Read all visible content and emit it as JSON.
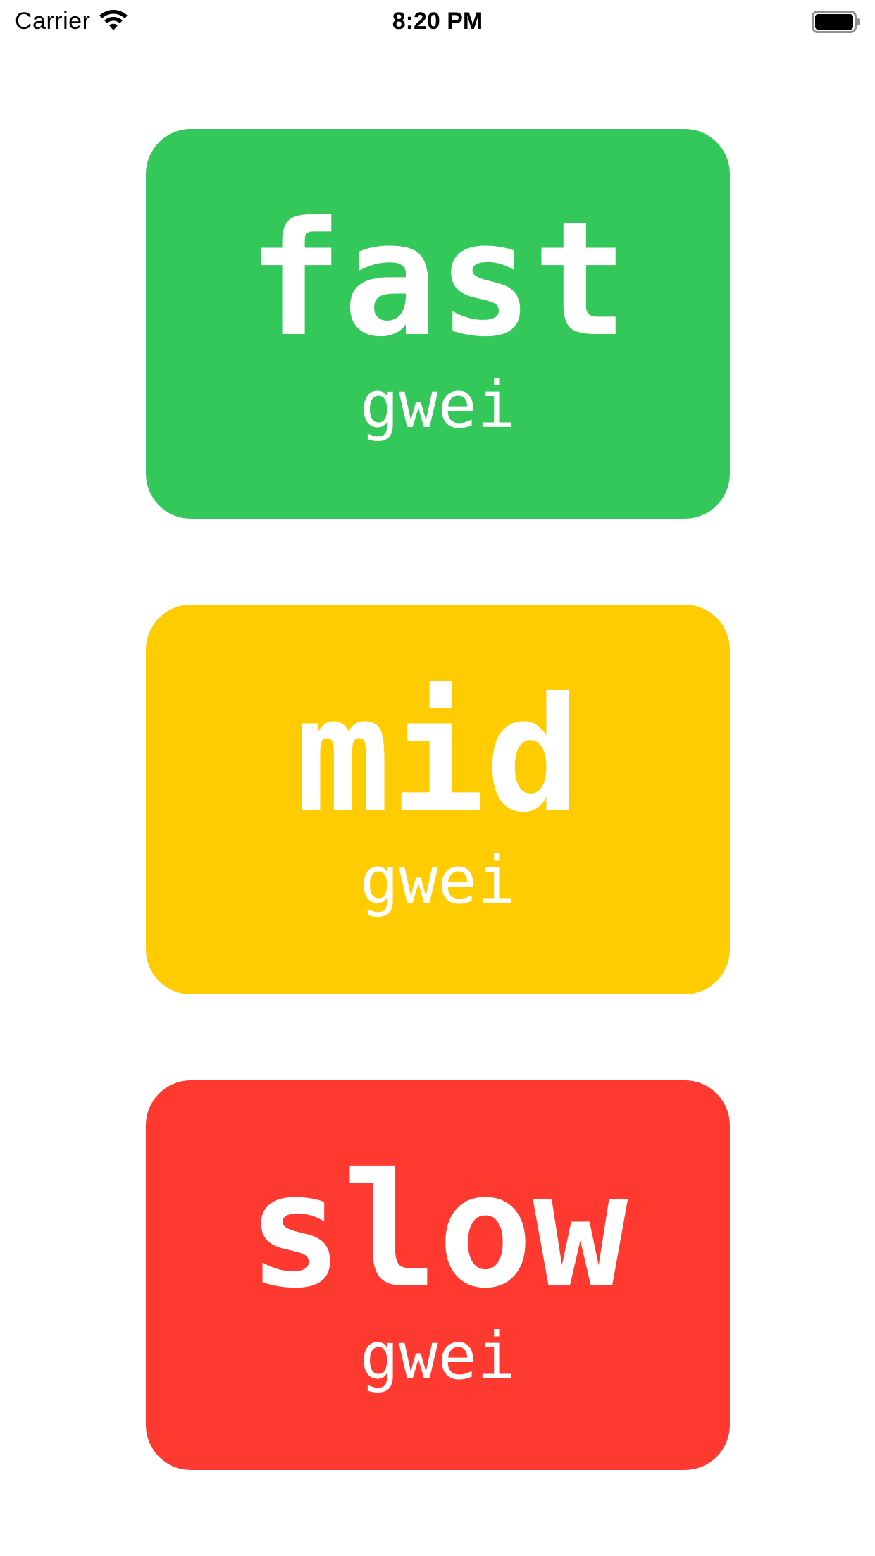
{
  "status_bar": {
    "carrier": "Carrier",
    "time": "8:20 PM",
    "wifi_icon": "wifi-icon",
    "battery_icon": "battery-icon"
  },
  "cards": {
    "fast": {
      "label": "fast",
      "unit": "gwei",
      "color": "#34C85A"
    },
    "mid": {
      "label": "mid",
      "unit": "gwei",
      "color": "#FECC00"
    },
    "slow": {
      "label": "slow",
      "unit": "gwei",
      "color": "#FE3A30"
    }
  }
}
